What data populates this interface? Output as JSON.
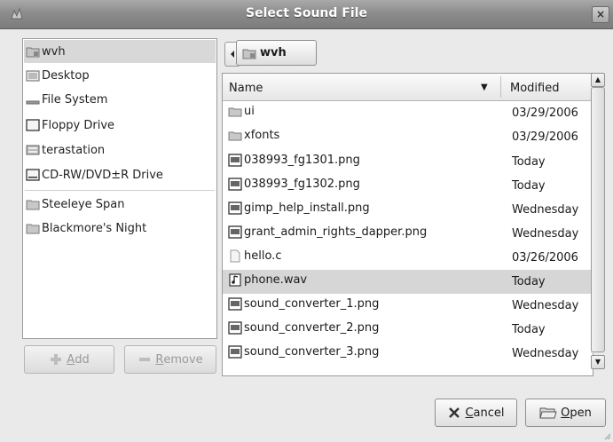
{
  "window": {
    "title": "Select Sound File",
    "close_label": "×"
  },
  "places": {
    "items": [
      {
        "label": "wvh",
        "icon": "home-folder-icon",
        "selected": true
      },
      {
        "label": "Desktop",
        "icon": "desktop-icon"
      },
      {
        "label": "File System",
        "icon": "filesystem-icon"
      },
      {
        "label": "Floppy Drive",
        "icon": "floppy-drive-icon"
      },
      {
        "label": "terastation",
        "icon": "network-drive-icon"
      },
      {
        "label": "CD-RW/DVD±R Drive",
        "icon": "optical-drive-icon"
      }
    ],
    "bookmarks": [
      {
        "label": "Steeleye Span",
        "icon": "folder-icon"
      },
      {
        "label": "Blackmore's Night",
        "icon": "folder-icon"
      }
    ],
    "add_prefix": "Add",
    "add_underline": "A",
    "add_rest": "dd",
    "remove_underline": "R",
    "remove_rest": "emove"
  },
  "pathbar": {
    "current": "wvh"
  },
  "file_list": {
    "columns": {
      "name": "Name",
      "modified": "Modified"
    },
    "rows": [
      {
        "name": "ui",
        "modified": "03/29/2006",
        "icon": "folder-icon"
      },
      {
        "name": "xfonts",
        "modified": "03/29/2006",
        "icon": "folder-icon"
      },
      {
        "name": "038993_fg1301.png",
        "modified": "Today",
        "icon": "image-file-icon"
      },
      {
        "name": "038993_fg1302.png",
        "modified": "Today",
        "icon": "image-file-icon"
      },
      {
        "name": "gimp_help_install.png",
        "modified": "Wednesday",
        "icon": "image-file-icon"
      },
      {
        "name": "grant_admin_rights_dapper.png",
        "modified": "Wednesday",
        "icon": "image-file-icon"
      },
      {
        "name": "hello.c",
        "modified": "03/26/2006",
        "icon": "text-file-icon"
      },
      {
        "name": "phone.wav",
        "modified": "Today",
        "icon": "audio-file-icon",
        "selected": true
      },
      {
        "name": "sound_converter_1.png",
        "modified": "Wednesday",
        "icon": "image-file-icon"
      },
      {
        "name": "sound_converter_2.png",
        "modified": "Today",
        "icon": "image-file-icon"
      },
      {
        "name": "sound_converter_3.png",
        "modified": "Wednesday",
        "icon": "image-file-icon"
      }
    ]
  },
  "buttons": {
    "cancel_underline": "C",
    "cancel_rest": "ancel",
    "open_underline": "O",
    "open_rest": "pen"
  }
}
